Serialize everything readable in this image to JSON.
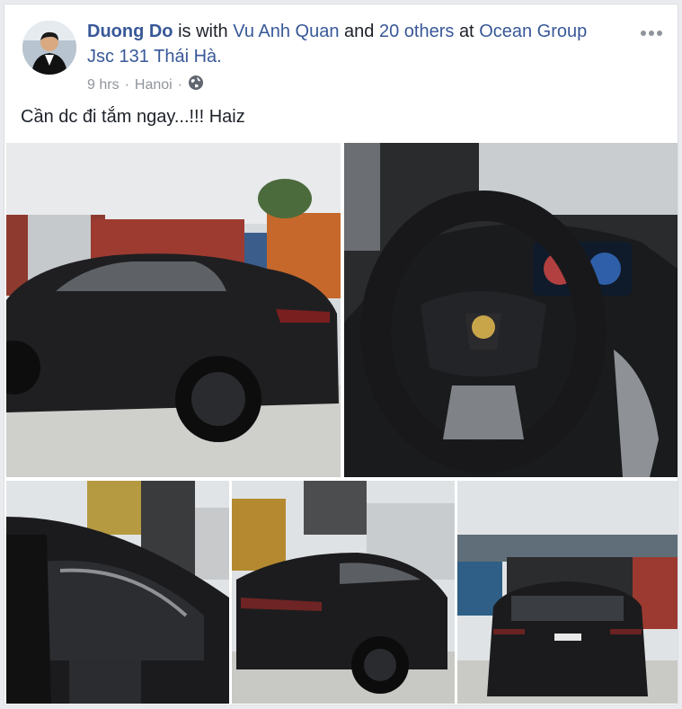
{
  "post": {
    "author": "Duong Do",
    "with_text": "is with",
    "tagged_person": "Vu Anh Quan",
    "and_text": "and",
    "others": "20 others",
    "at_text": "at",
    "place": "Ocean Group Jsc 131 Thái Hà.",
    "time": "9 hrs",
    "location": "Hanoi",
    "privacy_icon": "globe-icon",
    "menu_icon": "more-horizontal-icon",
    "text": "Cần dc đi tắm ngay...!!! Haiz"
  },
  "photos": [
    {
      "subject": "black-suv-side-view"
    },
    {
      "subject": "steering-wheel-interior"
    },
    {
      "subject": "car-interior-open-door"
    },
    {
      "subject": "black-suv-rear-three-quarter"
    },
    {
      "subject": "black-suv-rear-container"
    }
  ]
}
